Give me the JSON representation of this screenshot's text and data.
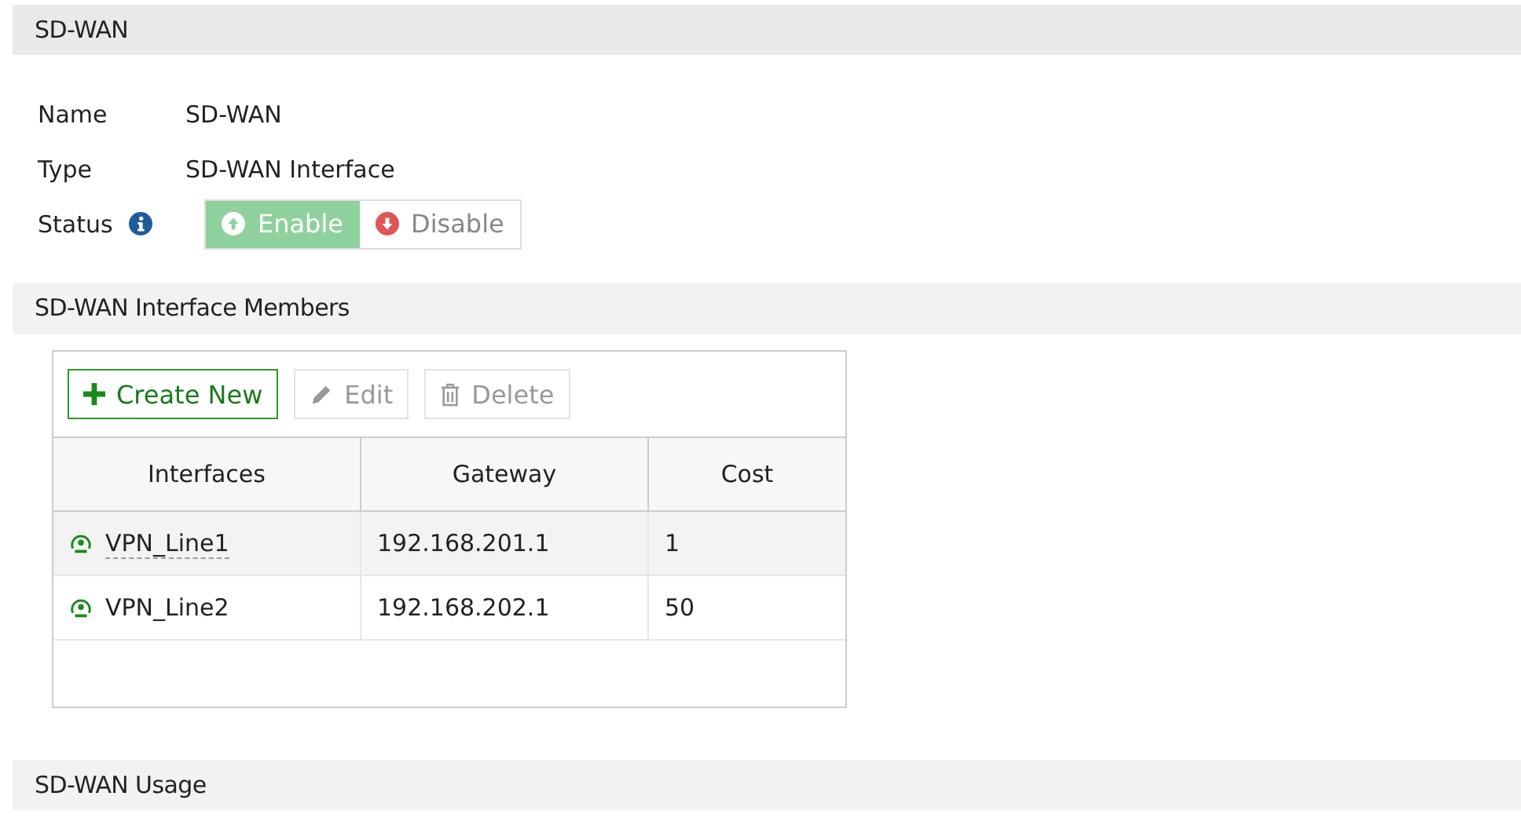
{
  "sections": [
    {
      "title": "SD-WAN"
    },
    {
      "title": "SD-WAN Interface Members"
    },
    {
      "title": "SD-WAN Usage"
    }
  ],
  "fields": [
    {
      "label": "Name",
      "value": "SD-WAN"
    },
    {
      "label": "Type",
      "value": "SD-WAN Interface"
    }
  ],
  "status": {
    "label": "Status",
    "options": [
      {
        "label": "Enable",
        "selected": true
      },
      {
        "label": "Disable",
        "selected": false
      }
    ]
  },
  "toolbar": [
    {
      "label": "Create New",
      "kind": "create",
      "disabled": false
    },
    {
      "label": "Edit",
      "kind": "edit",
      "disabled": true
    },
    {
      "label": "Delete",
      "kind": "delete",
      "disabled": true
    }
  ],
  "table": {
    "columns": [
      "Interfaces",
      "Gateway",
      "Cost"
    ],
    "rows": [
      {
        "interface": "VPN_Line1",
        "gateway": "192.168.201.1",
        "cost": "1",
        "selected": true
      },
      {
        "interface": "VPN_Line2",
        "gateway": "192.168.202.1",
        "cost": "50",
        "selected": false
      }
    ]
  }
}
